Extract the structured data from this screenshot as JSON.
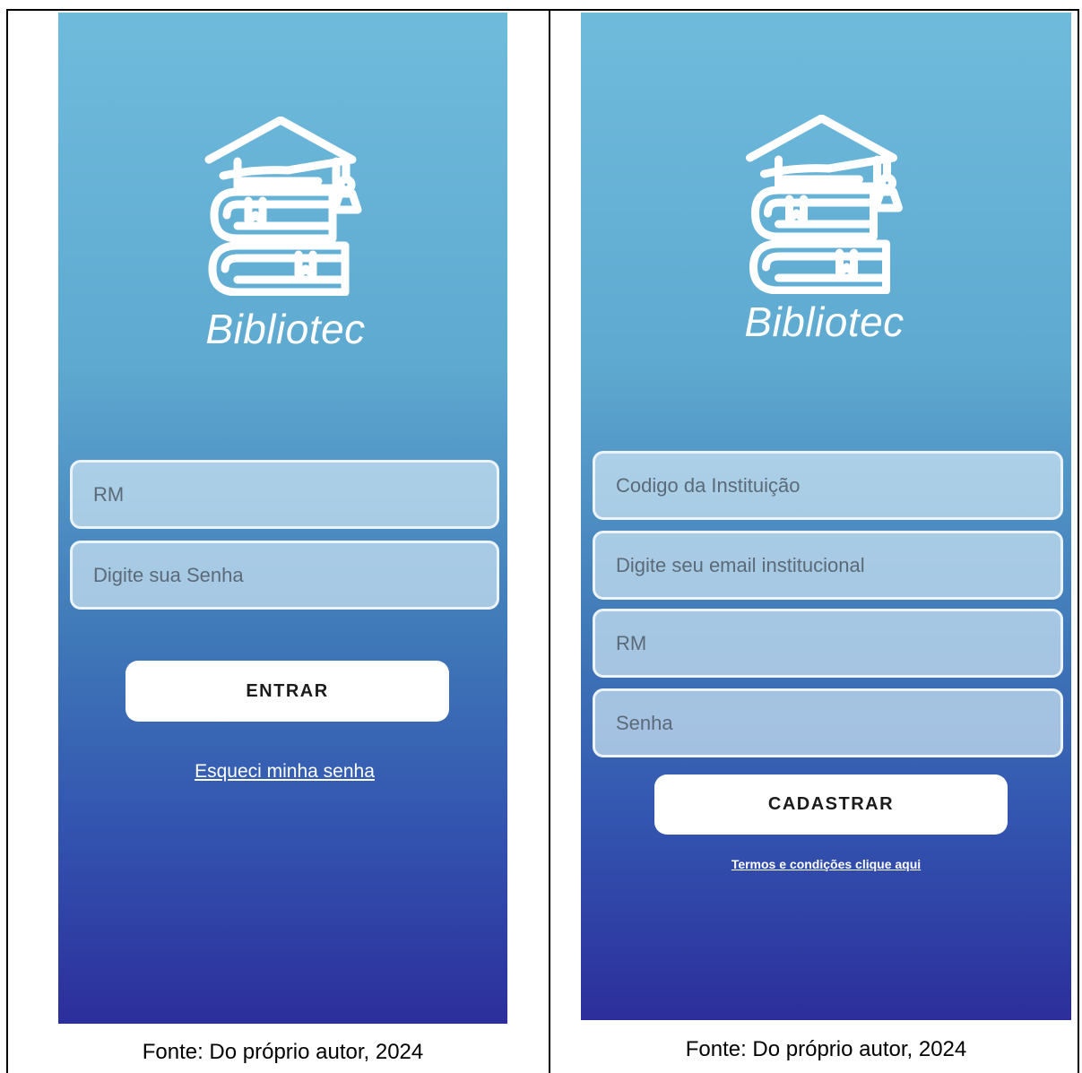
{
  "login_screen": {
    "brand": "Bibliotec",
    "rm_placeholder": "RM",
    "password_placeholder": "Digite sua Senha",
    "submit_label": "ENTRAR",
    "forgot_link": "Esqueci minha senha",
    "caption": "Fonte: Do próprio autor, 2024"
  },
  "signup_screen": {
    "brand": "Bibliotec",
    "institution_placeholder": "Codigo da Instituição",
    "email_placeholder": "Digite seu email institucional",
    "rm_placeholder": "RM",
    "password_placeholder": "Senha",
    "submit_label": "CADASTRAR",
    "terms_link": "Termos e condições clique aqui",
    "caption": "Fonte: Do próprio autor, 2024"
  },
  "icons": {
    "logo": "graduation-cap-books-icon"
  },
  "colors": {
    "gradient_top": "#6fbbdc",
    "gradient_bottom": "#2c2e9b",
    "field_border": "#ecf4fa"
  }
}
